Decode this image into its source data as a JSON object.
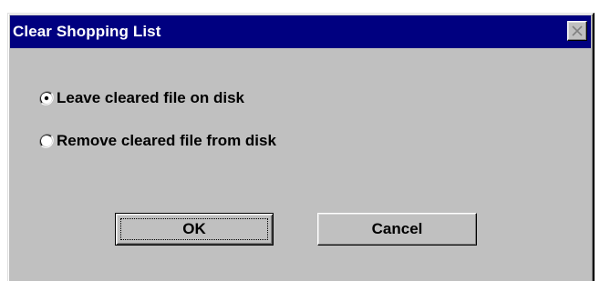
{
  "dialog": {
    "title": "Clear Shopping List",
    "close_icon": "close-icon"
  },
  "options": [
    {
      "label": "Leave cleared file on disk",
      "selected": true
    },
    {
      "label": "Remove cleared file from disk",
      "selected": false
    }
  ],
  "buttons": {
    "ok_label": "OK",
    "cancel_label": "Cancel"
  },
  "colors": {
    "titlebar": "#000080",
    "face": "#c0c0c0"
  }
}
